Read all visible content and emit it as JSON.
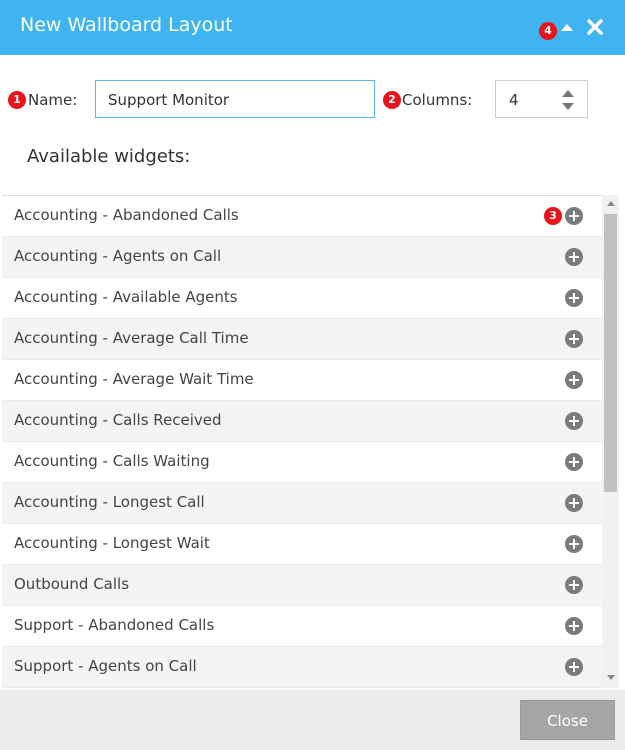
{
  "dialog": {
    "title": "New Wallboard Layout",
    "accent_color": "#3fb4f0"
  },
  "badges": {
    "b1": "1",
    "b2": "2",
    "b3": "3",
    "b4": "4"
  },
  "form": {
    "name_label": "Name:",
    "name_value": "Support Monitor",
    "columns_label": "Columns:",
    "columns_value": "4"
  },
  "widgets_heading": "Available widgets:",
  "widgets": [
    "Accounting - Abandoned Calls",
    "Accounting - Agents on Call",
    "Accounting - Available Agents",
    "Accounting - Average Call Time",
    "Accounting - Average Wait Time",
    "Accounting - Calls Received",
    "Accounting - Calls Waiting",
    "Accounting - Longest Call",
    "Accounting - Longest Wait",
    "Outbound Calls",
    "Support - Abandoned Calls",
    "Support - Agents on Call"
  ],
  "footer": {
    "close_label": "Close"
  },
  "icons": {
    "collapse": "chevron-up-icon",
    "close": "close-icon",
    "add": "plus-circle-icon"
  }
}
